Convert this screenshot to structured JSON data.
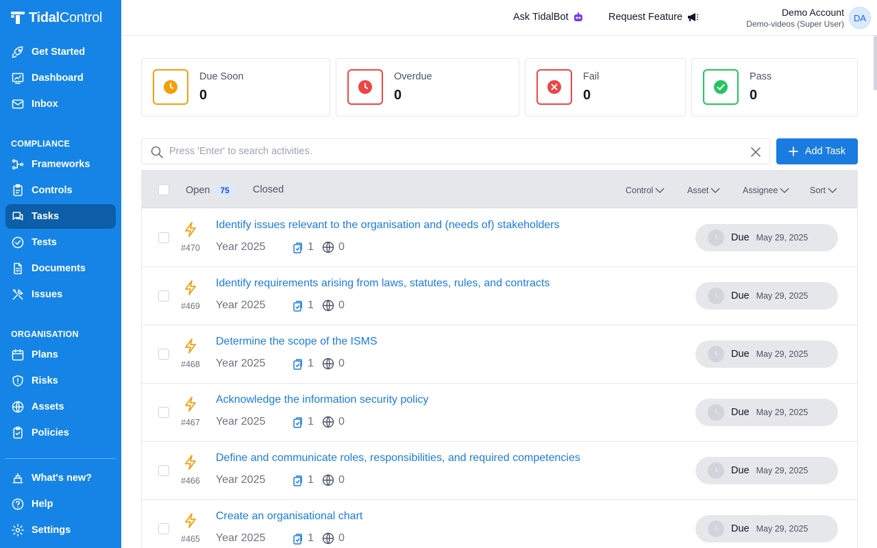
{
  "brand": {
    "name_bold": "Tidal",
    "name_light": "Control"
  },
  "sidebar": {
    "top_items": [
      {
        "label": "Get Started",
        "icon": "rocket-icon"
      },
      {
        "label": "Dashboard",
        "icon": "chart-icon"
      },
      {
        "label": "Inbox",
        "icon": "mail-icon"
      }
    ],
    "compliance_title": "COMPLIANCE",
    "compliance_items": [
      {
        "label": "Frameworks",
        "icon": "flow-icon"
      },
      {
        "label": "Controls",
        "icon": "clipboard-icon"
      },
      {
        "label": "Tasks",
        "icon": "chat-icon",
        "active": true
      },
      {
        "label": "Tests",
        "icon": "check-circle-icon"
      },
      {
        "label": "Documents",
        "icon": "document-icon"
      },
      {
        "label": "Issues",
        "icon": "tools-icon"
      }
    ],
    "organisation_title": "ORGANISATION",
    "organisation_items": [
      {
        "label": "Plans",
        "icon": "calendar-icon"
      },
      {
        "label": "Risks",
        "icon": "shield-icon"
      },
      {
        "label": "Assets",
        "icon": "globe-icon"
      },
      {
        "label": "Policies",
        "icon": "clipboard-check-icon"
      }
    ],
    "bottom_items": [
      {
        "label": "What's new?",
        "icon": "megaphone-icon"
      },
      {
        "label": "Help",
        "icon": "question-icon"
      },
      {
        "label": "Settings",
        "icon": "gear-icon"
      }
    ]
  },
  "topbar": {
    "ask_bot": "Ask TidalBot",
    "request_feature": "Request Feature",
    "account_name": "Demo Account",
    "account_role": "Demo-videos (Super User)",
    "avatar_initials": "DA"
  },
  "stats": [
    {
      "label": "Due Soon",
      "value": "0",
      "color": "#f59e0b"
    },
    {
      "label": "Overdue",
      "value": "0",
      "color": "#ef4444"
    },
    {
      "label": "Fail",
      "value": "0",
      "color": "#ef4444"
    },
    {
      "label": "Pass",
      "value": "0",
      "color": "#22c55e"
    }
  ],
  "search": {
    "placeholder": "Press 'Enter' to search activities."
  },
  "add_task_label": "Add Task",
  "list": {
    "tab_open": "Open",
    "open_count": "75",
    "tab_closed": "Closed",
    "filters": {
      "control": "Control",
      "asset": "Asset",
      "assignee": "Assignee",
      "sort": "Sort"
    }
  },
  "tasks": [
    {
      "id": "#470",
      "title": "Identify issues relevant to the organisation and (needs of) stakeholders",
      "year": "Year 2025",
      "controls": "1",
      "assets": "0",
      "due_label": "Due",
      "due_date": "May 29, 2025"
    },
    {
      "id": "#469",
      "title": "Identify requirements arising from laws, statutes, rules, and contracts",
      "year": "Year 2025",
      "controls": "1",
      "assets": "0",
      "due_label": "Due",
      "due_date": "May 29, 2025"
    },
    {
      "id": "#468",
      "title": "Determine the scope of the ISMS",
      "year": "Year 2025",
      "controls": "1",
      "assets": "0",
      "due_label": "Due",
      "due_date": "May 29, 2025"
    },
    {
      "id": "#467",
      "title": "Acknowledge the information security policy",
      "year": "Year 2025",
      "controls": "1",
      "assets": "0",
      "due_label": "Due",
      "due_date": "May 29, 2025"
    },
    {
      "id": "#466",
      "title": "Define and communicate roles, responsibilities, and required competencies",
      "year": "Year 2025",
      "controls": "1",
      "assets": "0",
      "due_label": "Due",
      "due_date": "May 29, 2025"
    },
    {
      "id": "#465",
      "title": "Create an organisational chart",
      "year": "Year 2025",
      "controls": "1",
      "assets": "0",
      "due_label": "Due",
      "due_date": "May 29, 2025"
    }
  ],
  "colors": {
    "sidebar": "#1584e6",
    "sidebar_active": "#0d5ea8",
    "accent": "#1a7ce0",
    "bolt": "#f59e0b"
  }
}
